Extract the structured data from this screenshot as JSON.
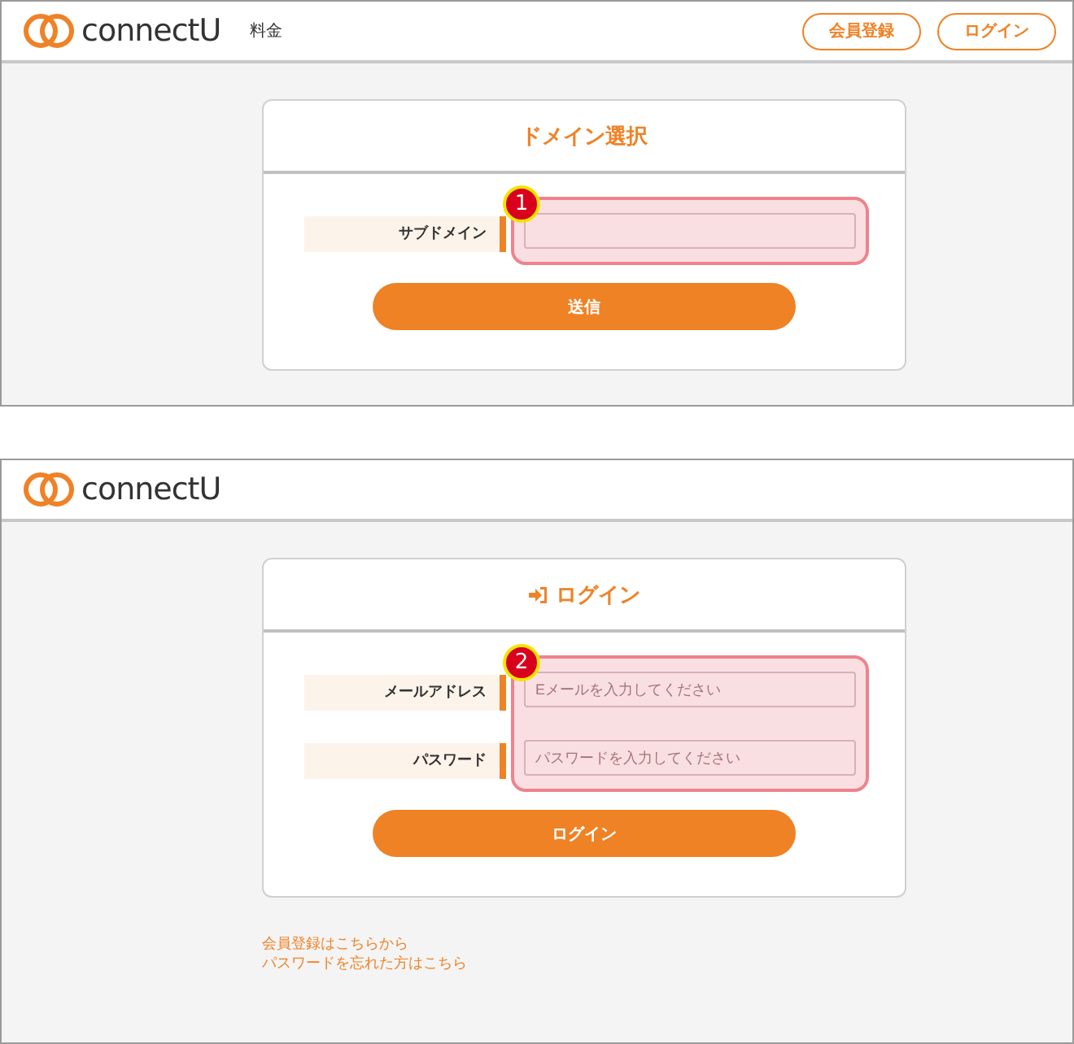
{
  "screens": [
    {
      "header": {
        "logo": "connectU",
        "nav": [
          {
            "label": "料金"
          }
        ],
        "buttons": [
          {
            "label": "会員登録"
          },
          {
            "label": "ログイン"
          }
        ]
      },
      "card": {
        "kind": "domain",
        "title": "ドメイン選択",
        "callout": "1",
        "fields": [
          {
            "label": "サブドメイン"
          }
        ],
        "submit": "送信"
      }
    },
    {
      "header": {
        "logo": "connectU"
      },
      "card": {
        "kind": "login",
        "title": "ログイン",
        "callout": "2",
        "fields": [
          {
            "label": "メールアドレス",
            "placeholder": "Eメールを入力してください"
          },
          {
            "label": "パスワード",
            "placeholder": "パスワードを入力してください"
          }
        ],
        "submit": "ログイン"
      },
      "links": [
        "会員登録はこちらから",
        "パスワードを忘れた方はこちら"
      ]
    }
  ]
}
